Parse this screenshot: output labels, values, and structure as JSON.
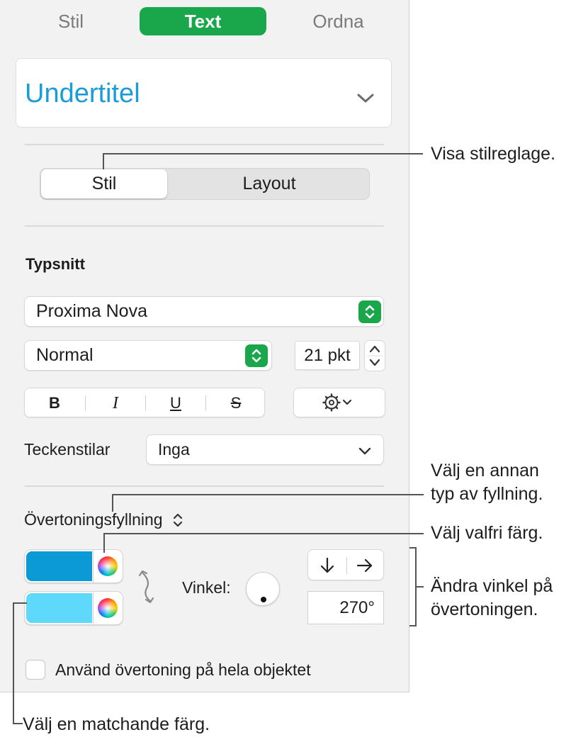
{
  "tabs": [
    {
      "label": "Stil",
      "active": false
    },
    {
      "label": "Text",
      "active": true
    },
    {
      "label": "Ordna",
      "active": false
    }
  ],
  "paragraph_style": {
    "label": "Undertitel",
    "color": "#1a9cd8"
  },
  "segmented": {
    "left": "Stil",
    "right": "Layout",
    "selected": "Stil"
  },
  "font": {
    "section_title": "Typsnitt",
    "family": "Proxima Nova",
    "typeface": "Normal",
    "size": "21 pkt",
    "format_buttons": {
      "bold": "B",
      "italic": "I",
      "underline": "U",
      "strike": "S"
    }
  },
  "char_styles": {
    "label": "Teckenstilar",
    "value": "Inga"
  },
  "fill": {
    "type_label": "Övertoningsfyllning",
    "color1": "#0b9ad6",
    "color2": "#5fd9fb",
    "angle_label": "Vinkel:",
    "angle_value": "270°",
    "apply_whole_object": "Använd övertoning på hela objektet",
    "apply_checked": false
  },
  "callouts": {
    "style_controls": "Visa stilreglage.",
    "fill_type_line1": "Välj en annan",
    "fill_type_line2": "typ av fyllning.",
    "any_color": "Välj valfri färg.",
    "angle_line1": "Ändra vinkel på",
    "angle_line2": "övertoningen.",
    "matching_color": "Välj en matchande färg."
  }
}
